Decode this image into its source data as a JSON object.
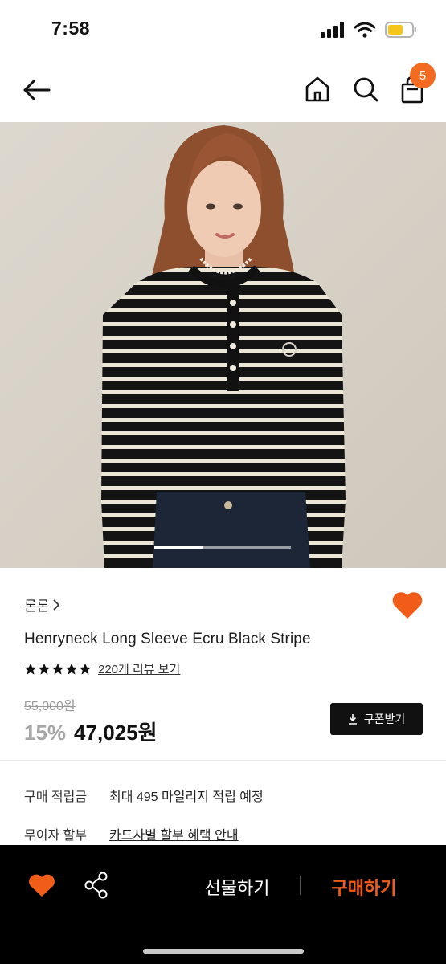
{
  "status_bar": {
    "time": "7:58"
  },
  "nav": {
    "cart_count": "5"
  },
  "colors": {
    "accent": "#f26b21",
    "buy": "#f25c19",
    "bottom_bar": "#000000"
  },
  "gallery": {
    "progress": 0.35
  },
  "product": {
    "brand": "론론",
    "title": "Henryneck Long Sleeve Ecru Black Stripe",
    "rating_stars": 5,
    "review_link": "220개 리뷰 보기",
    "original_price": "55,000원",
    "discount": "15%",
    "sale_price": "47,025원",
    "coupon_label": "쿠폰받기"
  },
  "info": {
    "points_label": "구매 적립금",
    "points_value": "최대 495 마일리지 적립 예정",
    "installment_label": "무이자 할부",
    "installment_value": "카드사별 할부 혜택 안내"
  },
  "bottom_bar": {
    "gift_label": "선물하기",
    "buy_label": "구매하기"
  },
  "icons": [
    "back-arrow-icon",
    "home-icon",
    "search-icon",
    "shopping-bag-icon",
    "heart-icon",
    "share-icon",
    "download-icon",
    "star-icon",
    "chevron-right-icon"
  ]
}
